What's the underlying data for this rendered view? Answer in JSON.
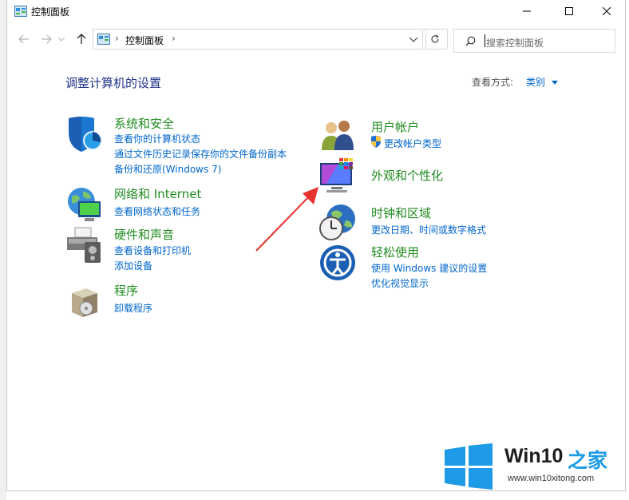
{
  "window": {
    "title": "控制面板"
  },
  "address": {
    "location": "控制面板",
    "separator": "›"
  },
  "search": {
    "placeholder": "搜索控制面板"
  },
  "heading": "调整计算机的设置",
  "view": {
    "label": "查看方式:",
    "value": "类别"
  },
  "categories": [
    {
      "title": "系统和安全",
      "links": [
        "查看你的计算机状态",
        "通过文件历史记录保存你的文件备份副本",
        "备份和还原(Windows 7)"
      ]
    },
    {
      "title": "网络和 Internet",
      "links": [
        "查看网络状态和任务"
      ]
    },
    {
      "title": "硬件和声音",
      "links": [
        "查看设备和打印机",
        "添加设备"
      ]
    },
    {
      "title": "程序",
      "links": [
        "卸载程序"
      ]
    },
    {
      "title": "用户帐户",
      "links": [
        "更改帐户类型"
      ]
    },
    {
      "title": "外观和个性化",
      "links": []
    },
    {
      "title": "时钟和区域",
      "links": [
        "更改日期、时间或数字格式"
      ]
    },
    {
      "title": "轻松使用",
      "links": [
        "使用 Windows 建议的设置",
        "优化视觉显示"
      ]
    }
  ],
  "watermark": {
    "brand": "Win10",
    "suffix": "之家",
    "url": "www.win10xitong.com"
  },
  "colors": {
    "category": "#1f8c1f",
    "link": "#0066cc",
    "heading": "#1e3287",
    "arrow": "#e8322d",
    "winlogo": "#1e9be6"
  },
  "icons": [
    "control-panel-icon",
    "back-arrow-icon",
    "forward-arrow-icon",
    "up-arrow-icon",
    "refresh-icon",
    "search-icon",
    "shield-icon",
    "globe-network-icon",
    "printer-icon",
    "program-box-icon",
    "users-icon",
    "monitor-palette-icon",
    "clock-globe-icon",
    "ease-of-access-icon",
    "windows-logo-icon"
  ]
}
